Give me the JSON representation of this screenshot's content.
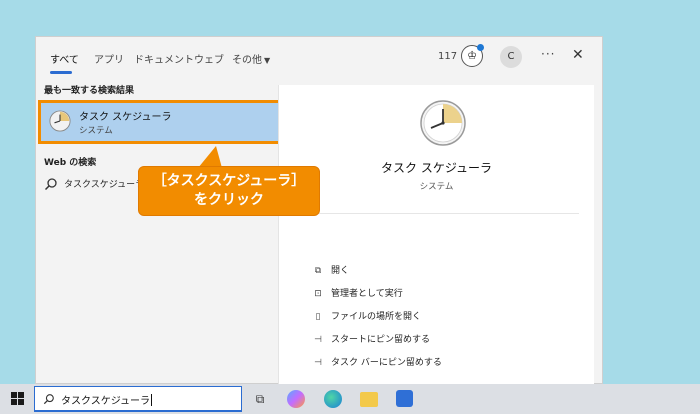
{
  "tabs": [
    {
      "label": "すべて",
      "active": true
    },
    {
      "label": "アプリ"
    },
    {
      "label": "ドキュメント"
    },
    {
      "label": "ウェブ"
    },
    {
      "label": "その他"
    }
  ],
  "header": {
    "count": "117",
    "avatar_letter": "C",
    "more_glyph": "···",
    "close_glyph": "✕"
  },
  "results": {
    "best_match_header": "最も一致する検索結果",
    "best_match": {
      "title": "タスク スケジューラ",
      "subtitle": "システム",
      "icon": "clock-icon"
    },
    "web_header": "Web の検索",
    "web_item": {
      "text": "タスクスケジューラ る",
      "icon": "search-icon"
    }
  },
  "detail": {
    "title": "タスク スケジューラ",
    "subtitle": "システム",
    "actions": [
      {
        "label": "開く",
        "icon": "open-icon"
      },
      {
        "label": "管理者として実行",
        "icon": "admin-icon"
      },
      {
        "label": "ファイルの場所を開く",
        "icon": "file-location-icon"
      },
      {
        "label": "スタートにピン留めする",
        "icon": "pin-icon"
      },
      {
        "label": "タスク バーにピン留めする",
        "icon": "pin-icon"
      }
    ]
  },
  "callout": {
    "line1": "［タスクスケジューラ］",
    "line2": "をクリック"
  },
  "taskbar": {
    "search_value": "タスクスケジューラ",
    "icons": [
      "task-view-icon",
      "copilot-icon",
      "edge-icon",
      "file-explorer-icon",
      "store-icon"
    ]
  },
  "colors": {
    "accent": "#2b6cd1",
    "highlight": "#f28c00",
    "selection": "#aed0ee"
  }
}
